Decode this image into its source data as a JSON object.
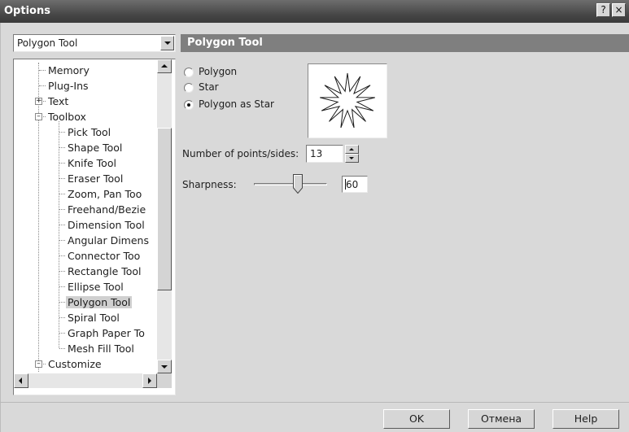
{
  "window": {
    "title": "Options",
    "help_glyph": "?",
    "close_glyph": "×"
  },
  "category_combo": {
    "selected": "Polygon Tool"
  },
  "tree": {
    "items": [
      {
        "label": "Memory",
        "level": 1
      },
      {
        "label": "Plug-Ins",
        "level": 1
      },
      {
        "label": "Text",
        "level": 1,
        "expander": "+"
      },
      {
        "label": "Toolbox",
        "level": 1,
        "expander": "−"
      },
      {
        "label": "Pick Tool",
        "level": 2
      },
      {
        "label": "Shape Tool",
        "level": 2
      },
      {
        "label": "Knife Tool",
        "level": 2
      },
      {
        "label": "Eraser Tool",
        "level": 2
      },
      {
        "label": "Zoom, Pan Too",
        "level": 2
      },
      {
        "label": "Freehand/Bezie",
        "level": 2
      },
      {
        "label": "Dimension Tool",
        "level": 2
      },
      {
        "label": "Angular Dimens",
        "level": 2
      },
      {
        "label": "Connector Too",
        "level": 2
      },
      {
        "label": "Rectangle Tool",
        "level": 2
      },
      {
        "label": "Ellipse Tool",
        "level": 2
      },
      {
        "label": "Polygon Tool",
        "level": 2,
        "selected": true
      },
      {
        "label": "Spiral Tool",
        "level": 2
      },
      {
        "label": "Graph Paper To",
        "level": 2
      },
      {
        "label": "Mesh Fill Tool",
        "level": 2
      },
      {
        "label": "Customize",
        "level": 1,
        "expander": "−"
      }
    ]
  },
  "panel": {
    "header": "Polygon Tool",
    "shape_options": [
      {
        "label": "Polygon",
        "checked": false
      },
      {
        "label": "Star",
        "checked": false
      },
      {
        "label": "Polygon as Star",
        "checked": true
      }
    ],
    "points_label": "Number of points/sides:",
    "points_value": "13",
    "sharpness_label": "Sharpness:",
    "sharpness_value": "60",
    "sharpness_fraction": 0.6,
    "preview_points": 13
  },
  "buttons": {
    "ok": "OK",
    "cancel": "Отмена",
    "help": "Help"
  },
  "colors": {
    "titlebar": "#444444",
    "panel_header": "#7f7f7f",
    "dialog_bg": "#d9d9d9",
    "selection": "#d0d0d0"
  }
}
